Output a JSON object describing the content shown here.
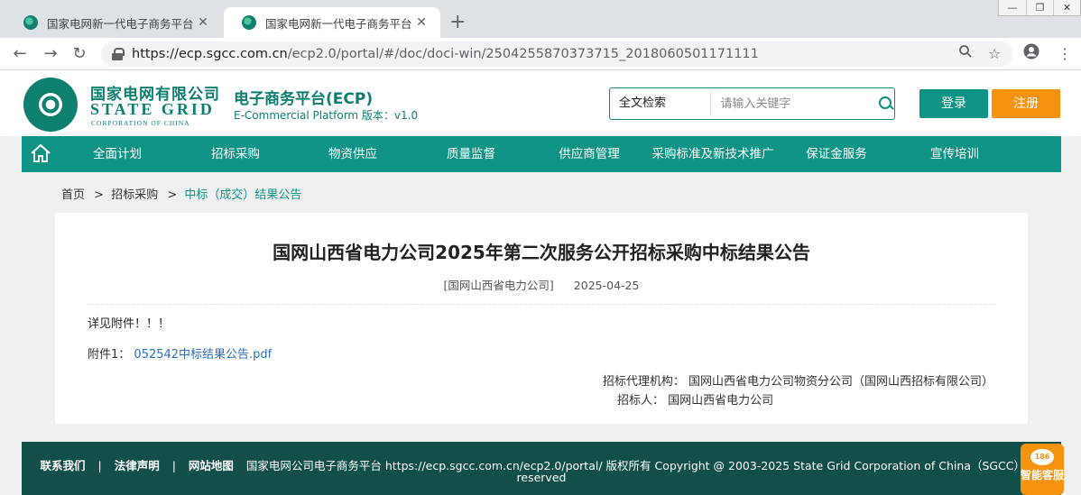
{
  "browser": {
    "tabs": [
      {
        "title": "国家电网新一代电子商务平台",
        "active": false
      },
      {
        "title": "国家电网新一代电子商务平台",
        "active": true
      }
    ],
    "new_tab": "+",
    "url_host": "https://ecp.sgcc.com.cn",
    "url_path": "/ecp2.0/portal/#/doc/doci-win/2504255870373715_2018060501171111",
    "icons": [
      "back-icon",
      "forward-icon",
      "reload-icon",
      "lock-icon",
      "zoom-icon",
      "star-icon",
      "account-icon",
      "menu-icon"
    ]
  },
  "header": {
    "logo_cn": "国家电网有限公司",
    "logo_en": "STATE GRID",
    "logo_en_sub": "CORPORATION OF CHINA",
    "platform_title": "电子商务平台(ECP)",
    "platform_subtitle": "E-Commercial Platform 版本：v1.0",
    "search_scope": "全文检索",
    "search_placeholder": "请输入关键字",
    "login_label": "登录",
    "register_label": "注册"
  },
  "nav": {
    "items": [
      "全面计划",
      "招标采购",
      "物资供应",
      "质量监督",
      "供应商管理",
      "采购标准及新技术推广",
      "保证金服务",
      "宣传培训"
    ]
  },
  "breadcrumb": {
    "items": [
      "首页",
      "招标采购"
    ],
    "separator": ">",
    "current": "中标（成交）结果公告"
  },
  "notice": {
    "title": "国网山西省电力公司2025年第二次服务公开招标采购中标结果公告",
    "publisher": "[国网山西省电力公司]",
    "date": "2025-04-25",
    "body": "详见附件！！！",
    "attachment_label": "附件1：",
    "attachment_name": "052542中标结果公告.pdf",
    "agent_label": "招标代理机构：",
    "agent_value": "国网山西省电力公司物资分公司（国网山西招标有限公司）",
    "tenderer_label": "招标人：",
    "tenderer_value": "国网山西省电力公司"
  },
  "footer": {
    "links": [
      "联系我们",
      "法律声明",
      "网站地图"
    ],
    "separator": "|",
    "copyright_line1": "国家电网公司电子商务平台 https://ecp.sgcc.com.cn/ecp2.0/portal/ 版权所有 Copyright @ 2003-2025 State Grid Corporation of China（SGCC）.All",
    "copyright_line2": "reserved"
  },
  "widget": {
    "badge": "186",
    "label": "智能客服"
  },
  "colors": {
    "brand_green": "#0f9384",
    "accent_orange": "#f5930f",
    "footer_green": "#124f48"
  }
}
